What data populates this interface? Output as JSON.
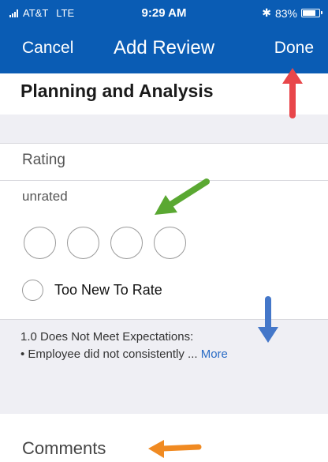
{
  "status_bar": {
    "carrier": "AT&T",
    "network": "LTE",
    "time": "9:29 AM",
    "bluetooth": "✱",
    "battery_percent": "83%",
    "battery_level": 0.83
  },
  "nav": {
    "cancel_label": "Cancel",
    "title": "Add Review",
    "done_label": "Done"
  },
  "section_title": "Planning and Analysis",
  "rating": {
    "label": "Rating",
    "value_text": "unrated",
    "circle_count": 4,
    "too_new_label": "Too New To Rate"
  },
  "description": {
    "line1": "1.0 Does Not Meet Expectations:",
    "line2": "• Employee did not consistently ...",
    "more_label": "More"
  },
  "comments_label": "Comments",
  "annotation_colors": {
    "red": "#e8464a",
    "green": "#5aa832",
    "blue": "#4477c9",
    "orange": "#f08a22"
  },
  "theme": {
    "nav_blue": "#0a5cb4",
    "link_blue": "#2a6cc5",
    "band_gray": "#efeff4"
  }
}
